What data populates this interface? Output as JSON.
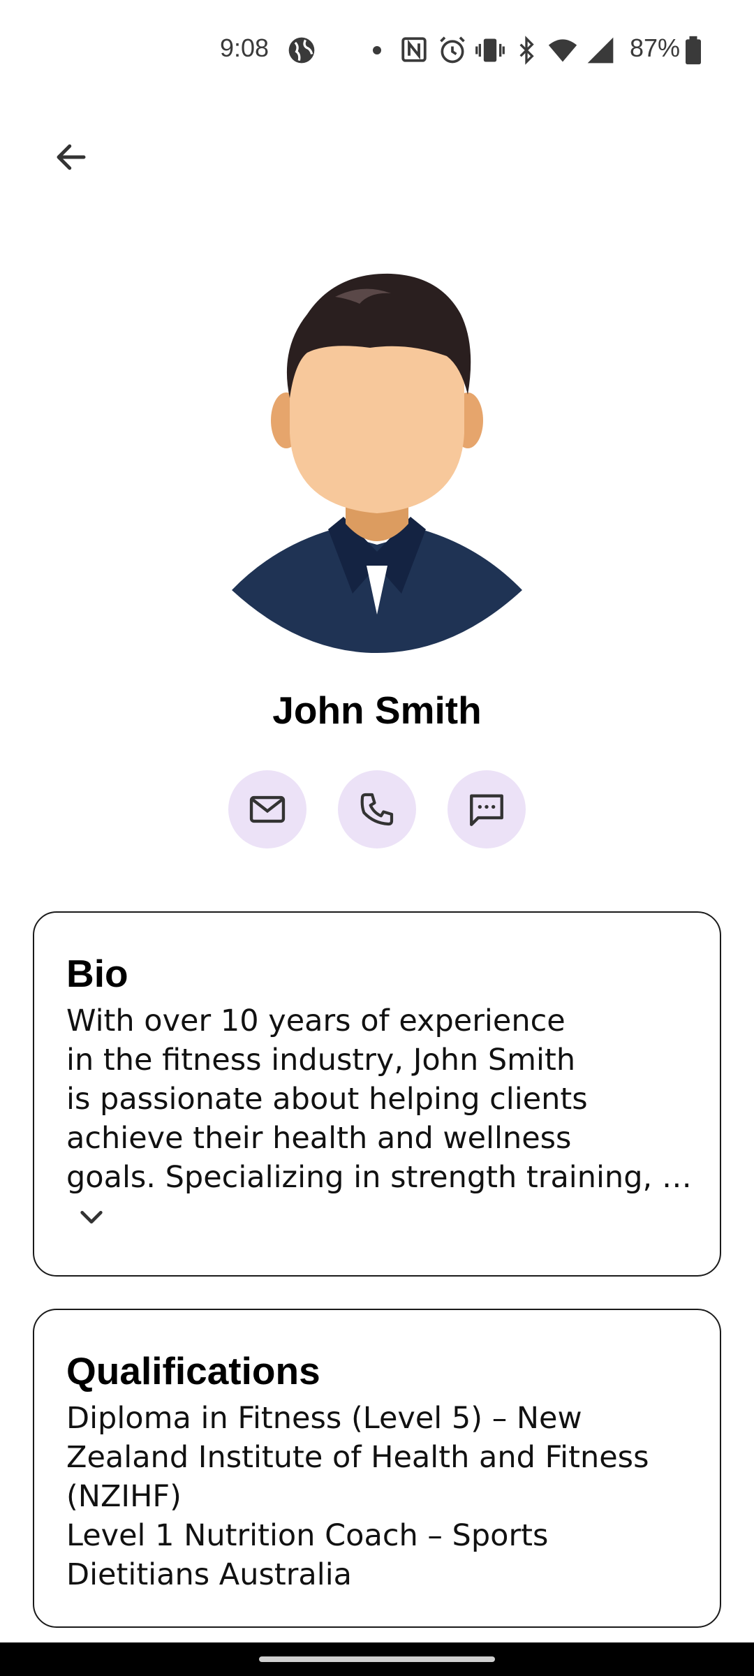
{
  "status_bar": {
    "time": "9:08",
    "battery": "87%",
    "icons": [
      "globe-icon",
      "dot-icon",
      "nfc-icon",
      "alarm-icon",
      "vibrate-icon",
      "bluetooth-icon",
      "wifi-icon",
      "signal-icon",
      "battery-icon"
    ]
  },
  "nav": {
    "back_icon": "arrow-left-icon"
  },
  "profile": {
    "name": "John Smith",
    "contact_actions": [
      "email",
      "phone",
      "message"
    ]
  },
  "bio": {
    "title": "Bio",
    "text": "With over 10 years of experience\nin the fitness industry, John Smith\nis passionate about helping clients\nachieve their health and wellness\ngoals. Specializing in strength training, …"
  },
  "qualifications": {
    "title": "Qualifications",
    "text": "Diploma in Fitness (Level 5) – New\nZealand Institute of Health and Fitness\n(NZIHF)\nLevel 1 Nutrition Coach – Sports\nDietitians Australia"
  },
  "colors": {
    "accent_bg": "#ece2f7",
    "shirt": "#1f3354",
    "hair": "#2a1f1f",
    "skin": "#f7c89b"
  }
}
